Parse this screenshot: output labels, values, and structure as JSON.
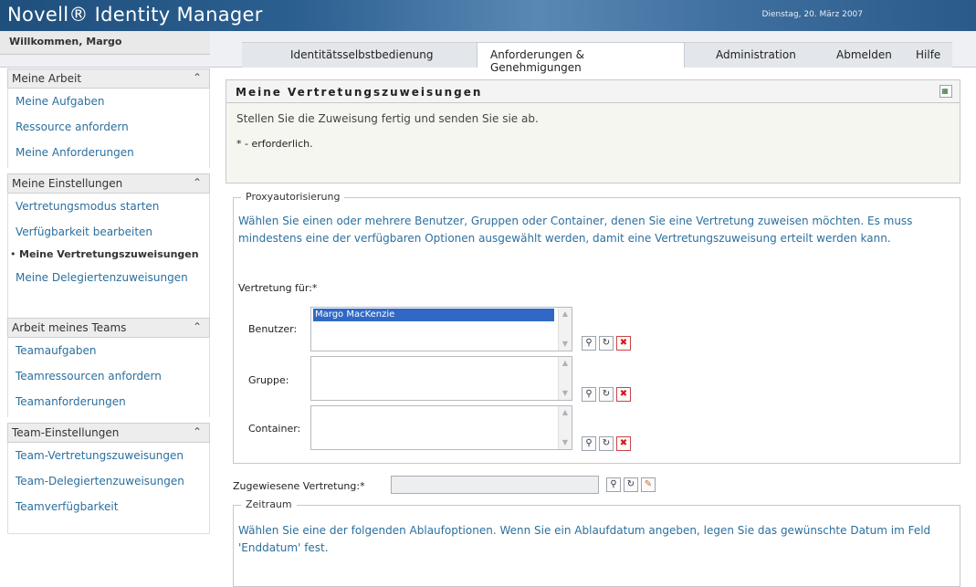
{
  "header": {
    "logo": "Novell® Identity Manager",
    "date": "Dienstag, 20. März 2007",
    "welcome": "Willkommen, Margo"
  },
  "tabs": [
    {
      "label": "Identitätsselbstbedienung"
    },
    {
      "label": "Anforderungen & Genehmigungen"
    },
    {
      "label": "Administration"
    },
    {
      "label": "Abmelden"
    },
    {
      "label": "Hilfe"
    }
  ],
  "sidebar": {
    "sections": [
      {
        "title": "Meine Arbeit",
        "items": [
          "Meine Aufgaben",
          "Ressource anfordern",
          "Meine Anforderungen"
        ]
      },
      {
        "title": "Meine Einstellungen",
        "items": [
          "Vertretungsmodus starten",
          "Verfügbarkeit bearbeiten",
          "Meine Vertretungszuweisungen",
          "Meine Delegiertenzuweisungen"
        ]
      },
      {
        "title": "Arbeit meines Teams",
        "items": [
          "Teamaufgaben",
          "Teamressourcen anfordern",
          "Teamanforderungen"
        ]
      },
      {
        "title": "Team-Einstellungen",
        "items": [
          "Team-Vertretungszuweisungen",
          "Team-Delegiertenzuweisungen",
          "Teamverfügbarkeit"
        ]
      }
    ]
  },
  "main": {
    "title": "Meine Vertretungszuweisungen",
    "message": "Stellen Sie die Zuweisung fertig und senden Sie sie ab.",
    "required_note": "* - erforderlich.",
    "proxy": {
      "legend": "Proxyautorisierung",
      "description": "Wählen Sie einen oder mehrere Benutzer, Gruppen oder Container, denen Sie eine Vertretung zuweisen möchten. Es muss mindestens eine der verfügbaren Optionen ausgewählt werden, damit eine Vertretungszuweisung erteilt werden kann.",
      "proxy_for_label": "Vertretung für:*",
      "user_label": "Benutzer:",
      "user_selected": "Margo MacKenzie",
      "group_label": "Gruppe:",
      "container_label": "Container:"
    },
    "assigned_label": "Zugewiesene Vertretung:*",
    "period": {
      "legend": "Zeitraum",
      "description": "Wählen Sie eine der folgenden Ablaufoptionen. Wenn Sie ein Ablaufdatum angeben, legen Sie das gewünschte Datum im Feld 'Enddatum' fest."
    }
  },
  "icons": {
    "search": "magnifier-icon",
    "history": "history-icon",
    "delete": "delete-icon",
    "edit": "edit-icon",
    "collapse": "collapse-chevron-icon"
  }
}
